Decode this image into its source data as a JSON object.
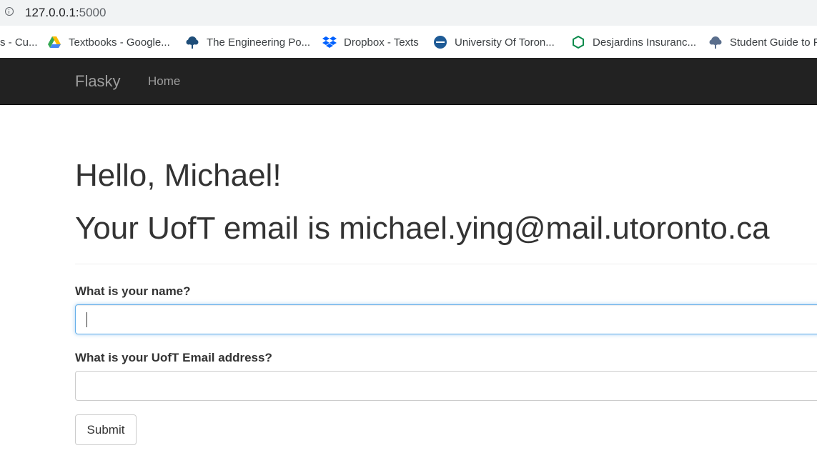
{
  "browser": {
    "url_host": "127.0.0.1:",
    "url_port": "5000",
    "bookmarks": [
      {
        "label": "s - Cu...",
        "icon": "none"
      },
      {
        "label": "Textbooks - Google...",
        "icon": "google-drive-icon"
      },
      {
        "label": "The Engineering Po...",
        "icon": "tree-crest-icon"
      },
      {
        "label": "Dropbox - Texts",
        "icon": "dropbox-icon"
      },
      {
        "label": "University Of Toron...",
        "icon": "oth-badge-icon"
      },
      {
        "label": "Desjardins Insuranc...",
        "icon": "hexagon-icon"
      },
      {
        "label": "Student Guide to P",
        "icon": "tree-crest-icon"
      }
    ]
  },
  "navbar": {
    "brand": "Flasky",
    "home": "Home"
  },
  "page": {
    "greeting": "Hello, Michael!",
    "email_line": "Your UofT email is michael.ying@mail.utoronto.ca"
  },
  "form": {
    "name_label": "What is your name?",
    "name_value": "",
    "email_label": "What is your UofT Email address?",
    "email_value": "",
    "submit_label": "Submit"
  },
  "colors": {
    "navbar_bg": "#222222",
    "navbar_text": "#9d9d9d",
    "focus_border": "#66afe9"
  }
}
